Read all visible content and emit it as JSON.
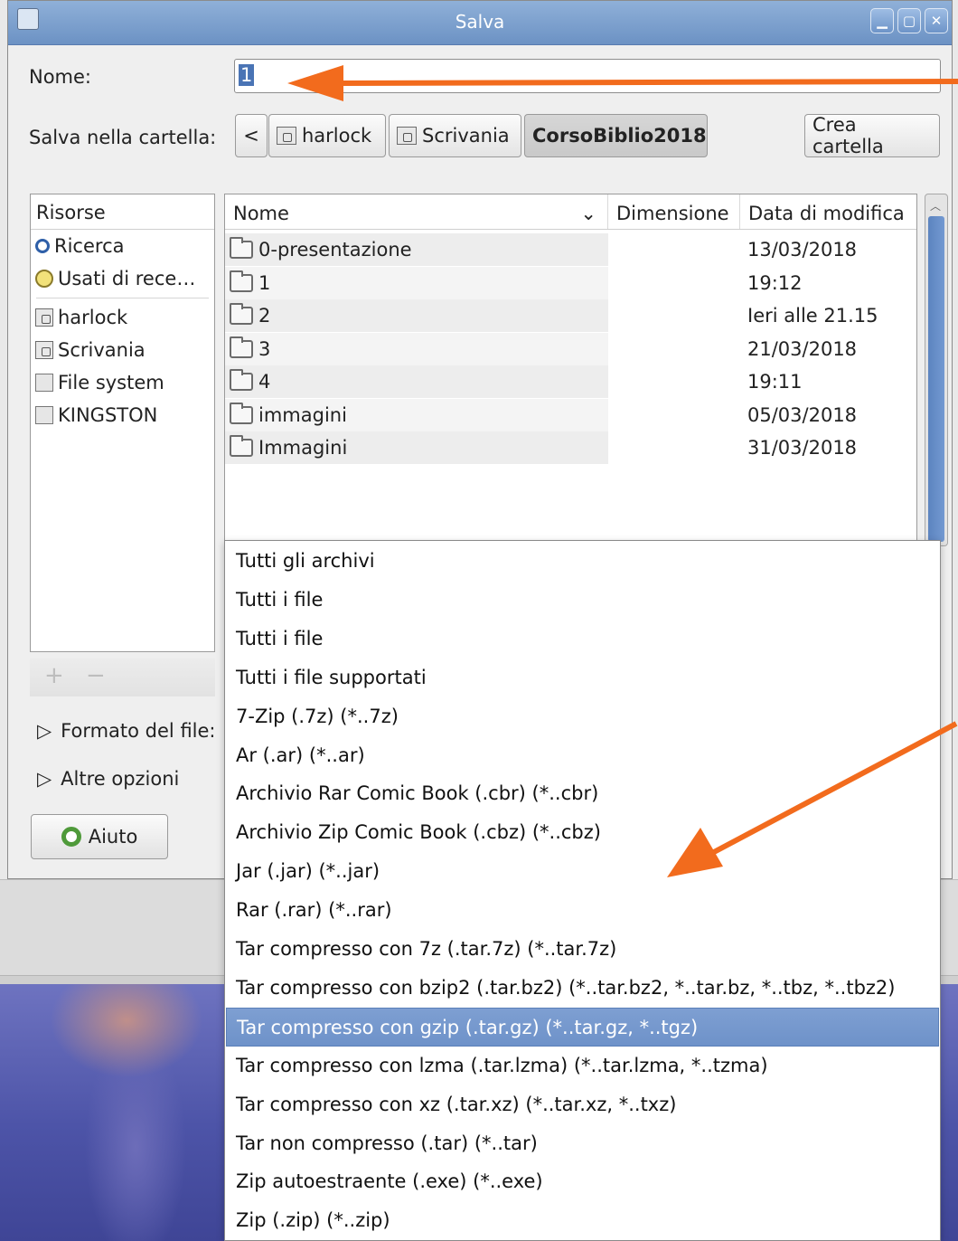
{
  "window": {
    "title": "Salva"
  },
  "labels": {
    "name": "Nome:",
    "save_in": "Salva nella cartella:",
    "create_folder": "Crea cartella",
    "format": "Formato del file:",
    "other_options": "Altre opzioni",
    "help": "Aiuto"
  },
  "name_field": {
    "value": "1"
  },
  "path_bar": {
    "back": "<",
    "crumbs": [
      "harlock",
      "Scrivania",
      "CorsoBiblio2018"
    ]
  },
  "places": {
    "header": "Risorse",
    "items": [
      {
        "label": "Ricerca",
        "icon": "search-icon"
      },
      {
        "label": "Usati di rece…",
        "icon": "recent-icon"
      },
      {
        "label": "harlock",
        "icon": "home-folder-icon"
      },
      {
        "label": "Scrivania",
        "icon": "desktop-icon"
      },
      {
        "label": "File system",
        "icon": "drive-icon"
      },
      {
        "label": "KINGSTON",
        "icon": "drive-icon"
      }
    ],
    "add": "+",
    "remove": "−"
  },
  "files": {
    "columns": {
      "name": "Nome",
      "size": "Dimensione",
      "modified": "Data di modifica"
    },
    "rows": [
      {
        "name": "0-presentazione",
        "modified": "13/03/2018"
      },
      {
        "name": "1",
        "modified": "19:12"
      },
      {
        "name": "2",
        "modified": "Ieri alle 21.15"
      },
      {
        "name": "3",
        "modified": "21/03/2018"
      },
      {
        "name": "4",
        "modified": "19:11"
      },
      {
        "name": "immagini",
        "modified": "05/03/2018"
      },
      {
        "name": "Immagini",
        "modified": "31/03/2018"
      }
    ]
  },
  "file_type_menu": {
    "selected_index": 12,
    "items": [
      "Tutti gli archivi",
      "Tutti i file",
      "Tutti i file",
      "Tutti i file supportati",
      "7-Zip (.7z) (*..7z)",
      "Ar (.ar) (*..ar)",
      "Archivio Rar Comic Book (.cbr) (*..cbr)",
      "Archivio Zip Comic Book (.cbz) (*..cbz)",
      "Jar (.jar) (*..jar)",
      "Rar (.rar) (*..rar)",
      "Tar compresso con 7z (.tar.7z) (*..tar.7z)",
      "Tar compresso con bzip2 (.tar.bz2) (*..tar.bz2, *..tar.bz, *..tbz, *..tbz2)",
      "Tar compresso con gzip (.tar.gz) (*..tar.gz, *..tgz)",
      "Tar compresso con lzma (.tar.lzma) (*..tar.lzma, *..tzma)",
      "Tar compresso con xz (.tar.xz) (*..tar.xz, *..txz)",
      "Tar non compresso (.tar) (*..tar)",
      "Zip autoestraente (.exe) (*..exe)",
      "Zip (.zip) (*..zip)"
    ]
  },
  "colors": {
    "annotation_arrow": "#f26b1d",
    "selection": "#6e92c9",
    "titlebar": "#7a9dcf"
  }
}
